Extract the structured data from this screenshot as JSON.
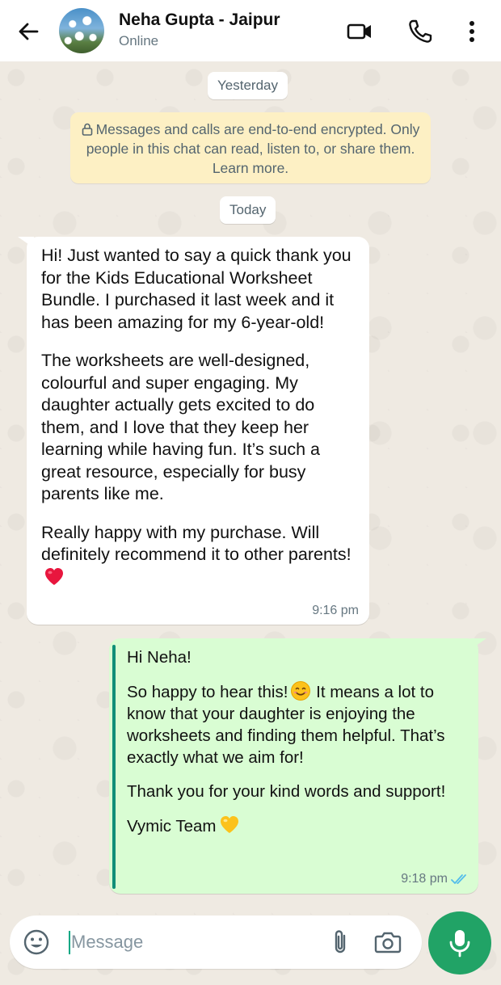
{
  "header": {
    "contact_name": "Neha Gupta - Jaipur",
    "status": "Online",
    "icons": [
      "back-arrow-icon",
      "video-call-icon",
      "phone-call-icon",
      "more-options-icon"
    ]
  },
  "chat": {
    "date_yesterday": "Yesterday",
    "encryption_notice": "Messages and calls are end-to-end encrypted. Only people in this chat can read, listen to, or share them. Learn more.",
    "date_today": "Today",
    "incoming": {
      "paragraphs": [
        "Hi! Just wanted to say a quick thank you for the Kids Educational Worksheet Bundle. I purchased it last week and it has been amazing for my 6-year-old!",
        "The worksheets are well-designed, colourful and super engaging. My daughter actually gets excited to do them, and I love that they keep her learning while having fun. It’s such a great resource, especially for busy parents like me.",
        "Really happy with my purchase. Will definitely recommend it to other parents!"
      ],
      "emoji": "red-heart",
      "time": "9:16 pm"
    },
    "outgoing": {
      "greeting": "Hi Neha!",
      "paragraph2": "So happy to hear this!",
      "paragraph2_emoji": "smiling-face",
      "paragraph2_rest": " It means a lot to know that your daughter is enjoying the worksheets and finding them helpful. That’s exactly what we aim for!",
      "paragraph3": "Thank you for your kind words and support!",
      "signature": "Vymic Team",
      "signature_emoji": "yellow-heart",
      "time": "9:18 pm",
      "read_status": "read"
    }
  },
  "composer": {
    "placeholder": "Message",
    "value": "",
    "icons": [
      "emoji-icon",
      "attach-icon",
      "camera-icon",
      "mic-icon"
    ]
  },
  "colors": {
    "incoming_bubble": "#ffffff",
    "outgoing_bubble": "#d9fdd3",
    "encryption_bg": "#fdf0c4",
    "accent": "#21a366",
    "read_ticks": "#53bdeb"
  }
}
